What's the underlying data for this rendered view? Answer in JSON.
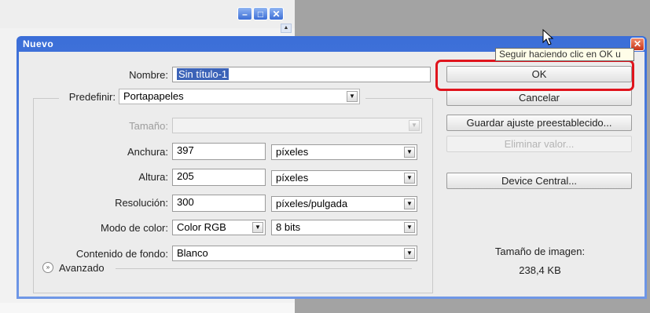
{
  "dialog": {
    "title": "Nuevo",
    "fields": {
      "nombre_label": "Nombre:",
      "nombre_value": "Sin título-1",
      "predefinir_label": "Predefinir:",
      "predefinir_value": "Portapapeles",
      "tamano_label": "Tamaño:",
      "tamano_value": "",
      "anchura_label": "Anchura:",
      "anchura_value": "397",
      "anchura_unit": "píxeles",
      "altura_label": "Altura:",
      "altura_value": "205",
      "altura_unit": "píxeles",
      "resolucion_label": "Resolución:",
      "resolucion_value": "300",
      "resolucion_unit": "píxeles/pulgada",
      "modo_label": "Modo de color:",
      "modo_value": "Color RGB",
      "modo_bits": "8 bits",
      "fondo_label": "Contenido de fondo:",
      "fondo_value": "Blanco",
      "avanzado_label": "Avanzado"
    },
    "buttons": {
      "ok": "OK",
      "cancel": "Cancelar",
      "save_preset": "Guardar ajuste preestablecido...",
      "delete_preset": "Eliminar valor...",
      "device_central": "Device Central..."
    },
    "tooltip": "Seguir haciendo clic en OK u",
    "image_size_label": "Tamaño de imagen:",
    "image_size_value": "238,4 KB"
  },
  "colors": {
    "titlebar": "#3b6ed8",
    "highlight": "#e0141d",
    "client_bg": "#ececec"
  }
}
